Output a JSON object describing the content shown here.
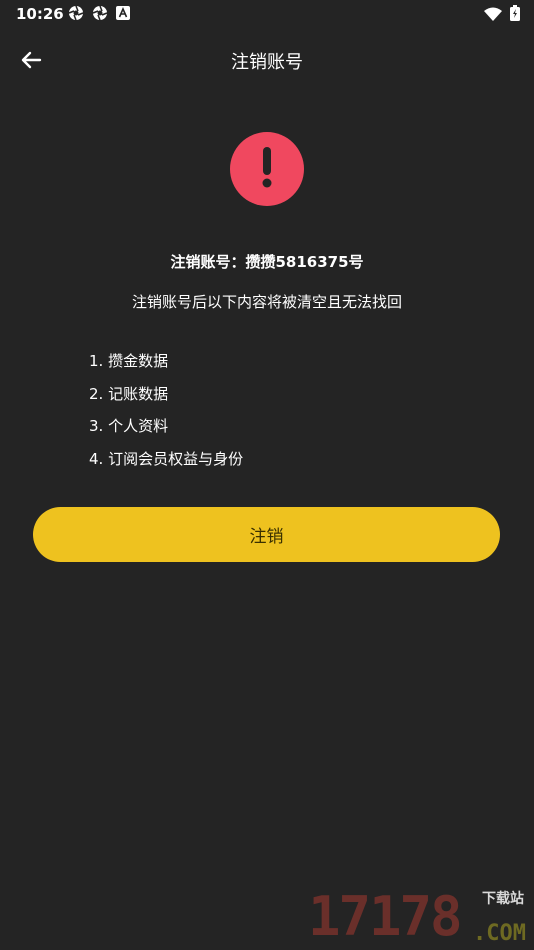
{
  "status_bar": {
    "time": "10:26",
    "left_icons": [
      "aperture-icon",
      "aperture-icon",
      "font-a-icon"
    ],
    "right_icons": [
      "wifi-icon",
      "battery-charging-icon"
    ]
  },
  "header": {
    "title": "注销账号",
    "back_icon": "arrow-left-icon"
  },
  "alert": {
    "icon": "exclamation-icon",
    "color": "#f0485f"
  },
  "content": {
    "account_text": "注销账号：攒攒5816375号",
    "warning_text": "注销账号后以下内容将被清空且无法找回",
    "items": [
      "1. 攒金数据",
      "2. 记账数据",
      "3. 个人资料",
      "4. 订阅会员权益与身份"
    ]
  },
  "action": {
    "cancel_label": "注销",
    "color": "#eec21f"
  },
  "watermark": {
    "digits": "17178",
    "cn": "下载站",
    "com": ".COM"
  }
}
